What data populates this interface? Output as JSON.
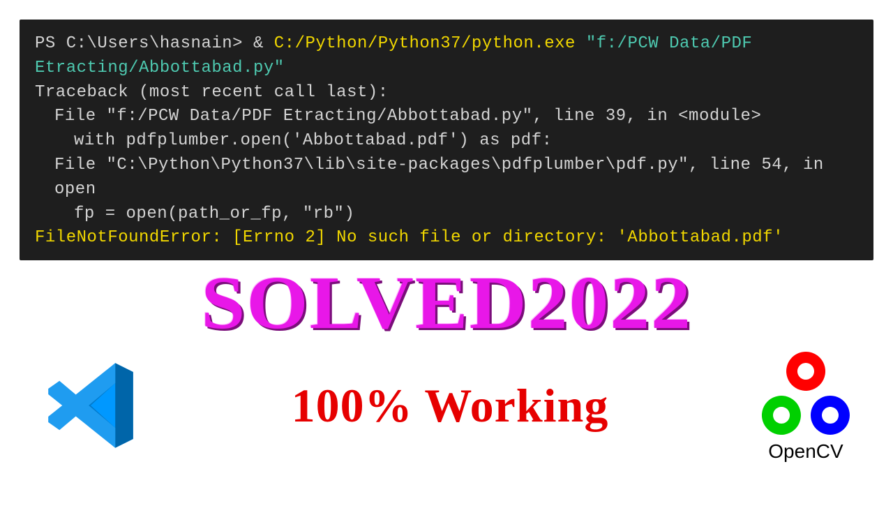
{
  "terminal": {
    "prompt": "PS C:\\Users\\hasnain> & ",
    "python_exe": "C:/Python/Python37/python.exe ",
    "script_arg": "\"f:/PCW Data/PDF Etracting/Abbottabad.py\"",
    "traceback_header": "Traceback (most recent call last):",
    "frame1_file": "File \"f:/PCW Data/PDF Etracting/Abbottabad.py\", line 39, in <module>",
    "frame1_code": "with pdfplumber.open('Abbottabad.pdf') as pdf:",
    "frame2_file": "File \"C:\\Python\\Python37\\lib\\site-packages\\pdfplumber\\pdf.py\", line 54, in open",
    "frame2_code": "fp = open(path_or_fp, \"rb\")",
    "error": "FileNotFoundError: [Errno 2] No such file or directory: 'Abbottabad.pdf'"
  },
  "banner": {
    "solved": "SOLVED2022",
    "working": "100% Working",
    "opencv": "OpenCV"
  },
  "colors": {
    "terminal_bg": "#1e1e1e",
    "text_default": "#d4d4d4",
    "text_yellow": "#f1d700",
    "text_teal": "#4ec9b0",
    "solved_magenta": "#e817e8",
    "working_red": "#e60000"
  }
}
